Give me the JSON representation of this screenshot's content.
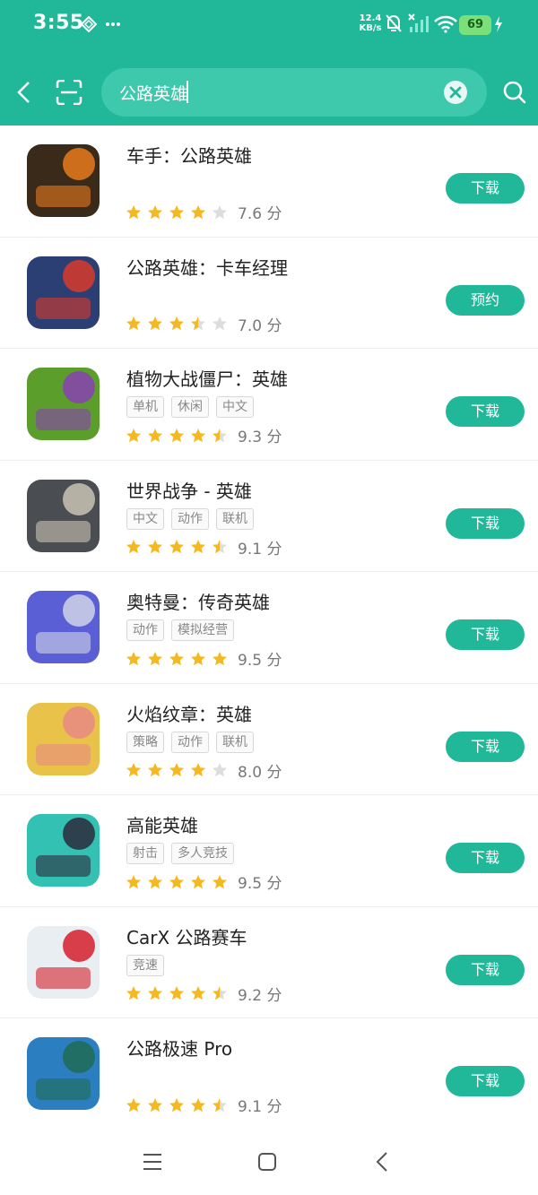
{
  "status_bar": {
    "time": "3:55",
    "net_speed_value": "12.4",
    "net_speed_unit": "KB/s",
    "battery": "69"
  },
  "search": {
    "query": "公路英雄"
  },
  "apps": [
    {
      "title": "车手：公路英雄",
      "tags": [],
      "rating": 4,
      "score": "7.6 分",
      "action": "下载",
      "icon": "highway-hero-icon",
      "bg": "#3a2a1a",
      "accent": "#e87a1e"
    },
    {
      "title": "公路英雄：卡车经理",
      "tags": [],
      "rating": 3.5,
      "score": "7.0 分",
      "action": "预约",
      "icon": "truck-manager-icon",
      "bg": "#2c3f74",
      "accent": "#d83b2a"
    },
    {
      "title": "植物大战僵尸：英雄",
      "tags": [
        "单机",
        "休闲",
        "中文"
      ],
      "rating": 4.5,
      "score": "9.3 分",
      "action": "下载",
      "icon": "pvz-heroes-icon",
      "bg": "#5b9e2c",
      "accent": "#8a3fb3"
    },
    {
      "title": "世界战争 - 英雄",
      "tags": [
        "中文",
        "动作",
        "联机"
      ],
      "rating": 4.5,
      "score": "9.1 分",
      "action": "下载",
      "icon": "wwii-icon",
      "bg": "#4a4e52",
      "accent": "#c9c3b4"
    },
    {
      "title": "奥特曼：传奇英雄",
      "tags": [
        "动作",
        "模拟经营"
      ],
      "rating": 5,
      "score": "9.5 分",
      "action": "下载",
      "icon": "ultraman-icon",
      "bg": "#5a5fd6",
      "accent": "#d0d4e6"
    },
    {
      "title": "火焰纹章：英雄",
      "tags": [
        "策略",
        "动作",
        "联机"
      ],
      "rating": 4,
      "score": "8.0 分",
      "action": "下载",
      "icon": "fire-emblem-icon",
      "bg": "#e9c24a",
      "accent": "#e98a84"
    },
    {
      "title": "高能英雄",
      "tags": [
        "射击",
        "多人竞技"
      ],
      "rating": 5,
      "score": "9.5 分",
      "action": "下载",
      "icon": "high-energy-hero-icon",
      "bg": "#33c1b3",
      "accent": "#2c2a3b"
    },
    {
      "title": "CarX 公路赛车",
      "tags": [
        "竞速"
      ],
      "rating": 4.5,
      "score": "9.2 分",
      "action": "下载",
      "icon": "carx-highway-icon",
      "bg": "#e9eef3",
      "accent": "#d41f2a"
    },
    {
      "title": "公路极速 Pro",
      "tags": [],
      "rating": 4.5,
      "score": "9.1 分",
      "action": "下载",
      "icon": "hrp-icon",
      "bg": "#2b7fc1",
      "accent": "#1f6b54"
    }
  ],
  "colors": {
    "brand": "#21b89a",
    "star": "#f5b81e",
    "star_empty": "#dddddd"
  }
}
